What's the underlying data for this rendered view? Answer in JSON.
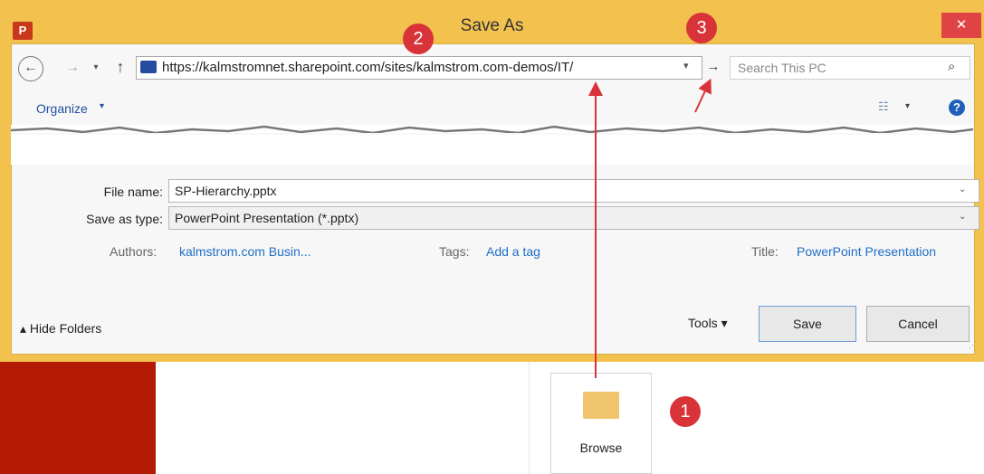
{
  "window": {
    "title": "Save As",
    "app_icon": "P",
    "close_label": "✕"
  },
  "nav": {
    "back_label": "←",
    "forward_label": "→",
    "recent_label": "▾",
    "up_label": "↑",
    "address": "https://kalmstromnet.sharepoint.com/sites/kalmstrom.com-demos/IT/",
    "address_dropdown": "▾",
    "go_label": "→",
    "search_placeholder": "Search This PC",
    "search_icon": "⌕"
  },
  "toolbar": {
    "organize_label": "Organize",
    "organize_caret": "▾",
    "view_icon": "☷",
    "view_caret": "▾",
    "help_label": "?"
  },
  "form": {
    "filename_label": "File name:",
    "filename_value": "SP-Hierarchy.pptx",
    "savetype_label": "Save as type:",
    "savetype_value": "PowerPoint Presentation (*.pptx)",
    "dropdown_caret": "⌄"
  },
  "meta": {
    "authors_label": "Authors:",
    "authors_value": "kalmstrom.com Busin...",
    "tags_label": "Tags:",
    "tags_value": "Add a tag",
    "title_label": "Title:",
    "title_value": "PowerPoint Presentation"
  },
  "footer": {
    "hide_folders_label": "▴ Hide Folders",
    "tools_label": "Tools ▾",
    "save_label": "Save",
    "cancel_label": "Cancel",
    "resize_grip": "⋰"
  },
  "backstage": {
    "browse_label": "Browse"
  },
  "annotations": {
    "badge_1": "1",
    "badge_2": "2",
    "badge_3": "3",
    "color": "#d9333a"
  }
}
